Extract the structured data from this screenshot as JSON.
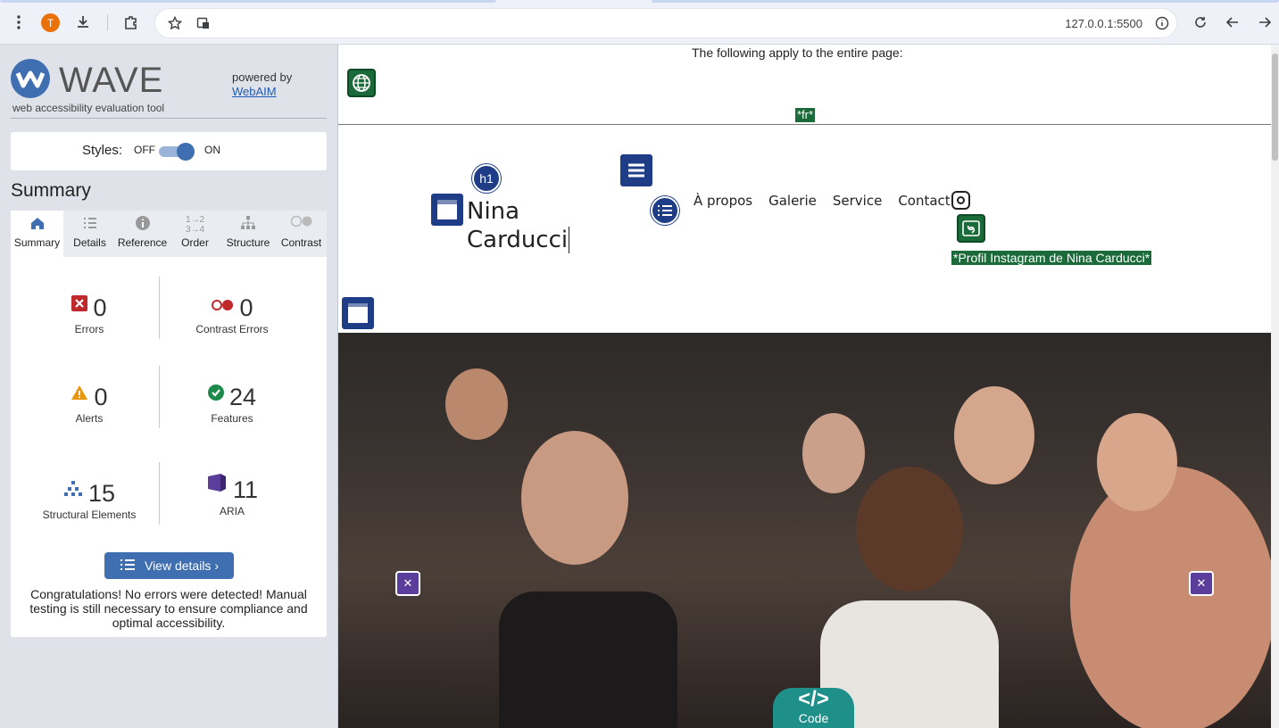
{
  "browser": {
    "avatar_letter": "T",
    "url": "127.0.0.1:5500"
  },
  "wave": {
    "title": "WAVE",
    "subtitle": "web accessibility evaluation tool",
    "powered_by": "powered by",
    "webaim_link": "WebAIM",
    "styles_label": "Styles:",
    "styles_off": "OFF",
    "styles_on": "ON",
    "styles_enabled": true,
    "summary_heading": "Summary",
    "tabs": [
      {
        "label": "Summary",
        "icon": "home-icon",
        "active": true
      },
      {
        "label": "Details",
        "icon": "list-icon",
        "active": false
      },
      {
        "label": "Reference",
        "icon": "info-icon",
        "active": false
      },
      {
        "label": "Order",
        "icon": "order-icon",
        "active": false
      },
      {
        "label": "Structure",
        "icon": "structure-icon",
        "active": false
      },
      {
        "label": "Contrast",
        "icon": "contrast-icon",
        "active": false
      }
    ],
    "stats": {
      "errors": {
        "value": "0",
        "label": "Errors"
      },
      "contrast_errors": {
        "value": "0",
        "label": "Contrast Errors"
      },
      "alerts": {
        "value": "0",
        "label": "Alerts"
      },
      "features": {
        "value": "24",
        "label": "Features"
      },
      "structural": {
        "value": "15",
        "label": "Structural Elements"
      },
      "aria": {
        "value": "11",
        "label": "ARIA"
      }
    },
    "view_details": "View details ›",
    "congrats": "Congratulations! No errors were detected! Manual testing is still necessary to ensure compliance and optimal accessibility."
  },
  "page": {
    "entire_page_note": "The following apply to the entire page:",
    "lang_label": "*fr*",
    "h1_badge": "h1",
    "site_title_line1": "Nina",
    "site_title_line2": "Carducci",
    "nav": [
      "À propos",
      "Galerie",
      "Service",
      "Contact"
    ],
    "instagram_alt": "*Profil Instagram de Nina Carducci*",
    "code_label": "Code",
    "code_symbol": "</>"
  },
  "colors": {
    "wave_blue": "#3f6fb0",
    "feature_green": "#1b6b3a",
    "structure_blue": "#1f3d87",
    "aria_purple": "#5b3d9c",
    "code_teal": "#1f8f8a"
  }
}
